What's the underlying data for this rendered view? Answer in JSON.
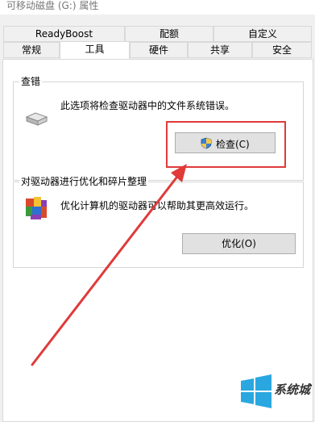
{
  "window": {
    "title": "可移动磁盘 (G:) 属性"
  },
  "tabs": {
    "row1": [
      "ReadyBoost",
      "配额",
      "自定义"
    ],
    "row2": [
      "常规",
      "工具",
      "硬件",
      "共享",
      "安全"
    ],
    "active": "工具"
  },
  "error_check": {
    "group_title": "查错",
    "description": "此选项将检查驱动器中的文件系统错误。",
    "button_label": "检查(C)",
    "icon": "drive-icon",
    "button_icon": "uac-shield-icon"
  },
  "optimize": {
    "group_title": "对驱动器进行优化和碎片整理",
    "description": "优化计算机的驱动器可以帮助其更高效运行。",
    "button_label": "优化(O)",
    "icon": "defrag-icon"
  },
  "annotation": {
    "highlight_color": "#e03a3a"
  },
  "watermark": {
    "text": "系统城"
  }
}
